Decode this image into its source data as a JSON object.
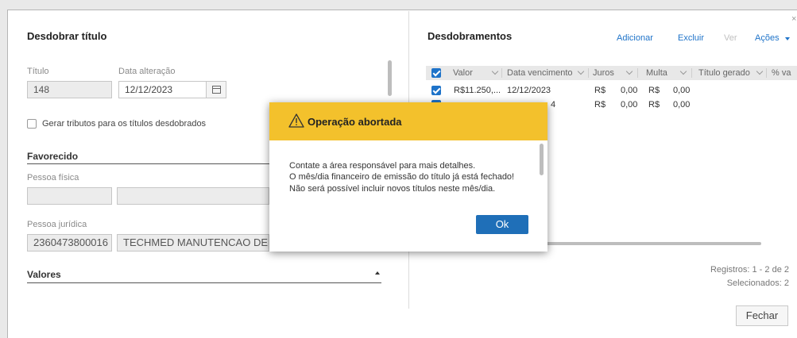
{
  "left": {
    "title": "Desdobrar título",
    "titulo_label": "Título",
    "titulo_value": "148",
    "data_alteracao_label": "Data alteração",
    "data_alteracao_value": "12/12/2023",
    "gerar_tributos_label": "Gerar tributos para os títulos desdobrados",
    "favorecido_section": "Favorecido",
    "pessoa_fisica_label": "Pessoa física",
    "pessoa_fisica_code": "",
    "pessoa_fisica_name": "",
    "pessoa_juridica_label": "Pessoa jurídica",
    "pessoa_juridica_code": "2360473800016",
    "pessoa_juridica_name": "TECHMED MANUTENCAO DE EQU",
    "valores_section": "Valores"
  },
  "right": {
    "title": "Desdobramentos",
    "actions": {
      "adicionar": "Adicionar",
      "excluir": "Excluir",
      "ver": "Ver",
      "acoes": "Ações"
    },
    "columns": [
      "Valor",
      "Data vencimento",
      "Juros",
      "Multa",
      "Título gerado",
      "% va"
    ],
    "rows": [
      {
        "checked": true,
        "valor": "R$11.250,...",
        "vencimento": "12/12/2023",
        "juros_cur": "R$",
        "juros": "0,00",
        "multa_cur": "R$",
        "multa": "0,00"
      },
      {
        "checked": true,
        "valor": "",
        "vencimento": "4",
        "juros_cur": "R$",
        "juros": "0,00",
        "multa_cur": "R$",
        "multa": "0,00"
      }
    ],
    "registros": "Registros: 1 - 2 de 2",
    "selecionados": "Selecionados: 2",
    "fechar": "Fechar"
  },
  "modal": {
    "title": "Operação abortada",
    "lines": [
      "Contate a área responsável para mais detalhes.",
      "O mês/dia financeiro de emissão do título já está fechado!",
      "Não será possível incluir novos títulos neste mês/dia."
    ],
    "ok": "Ok"
  },
  "colors": {
    "accent": "#1e73c9",
    "warning": "#f3c12c",
    "ok_button": "#1f6fb8"
  }
}
